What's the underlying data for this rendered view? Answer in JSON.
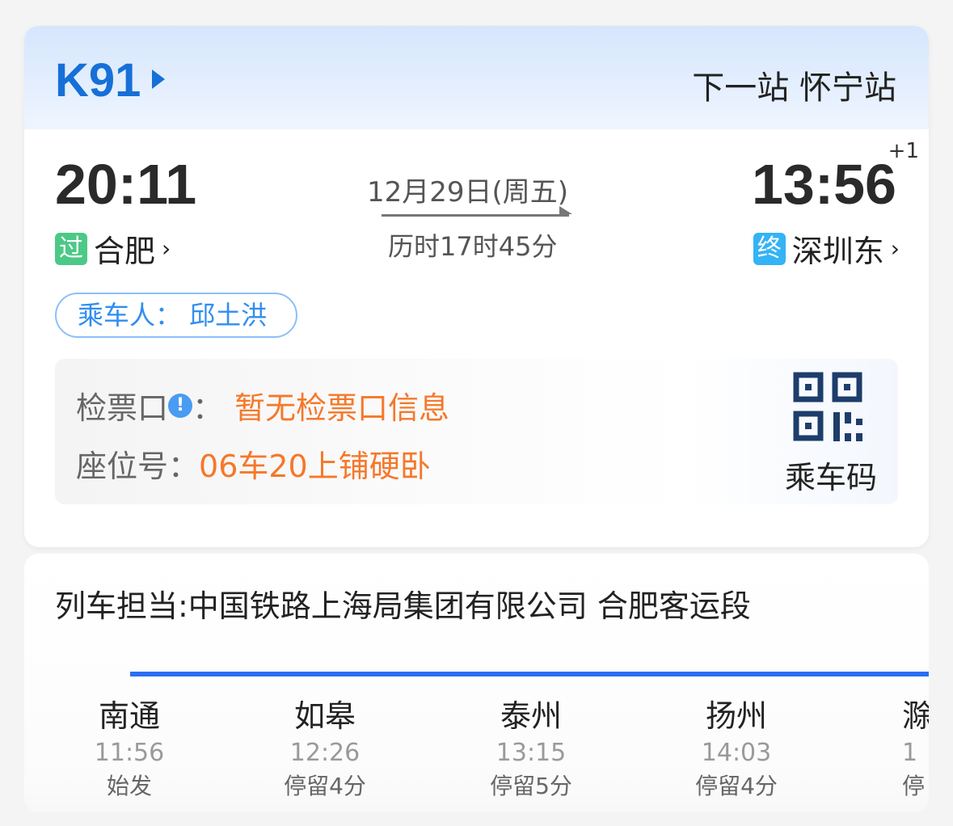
{
  "train": {
    "number": "K91",
    "next_station": "下一站 怀宁站"
  },
  "journey": {
    "depart_time": "20:11",
    "depart_tag": "过",
    "depart_station": "合肥",
    "arrive_time": "13:56",
    "day_offset": "+1",
    "arrive_tag": "终",
    "arrive_station": "深圳东",
    "date": "12月29日(周五)",
    "duration": "历时17时45分"
  },
  "passenger": "乘车人： 邱土洪",
  "ticket": {
    "gate_label": "检票口",
    "gate_sep": "：",
    "gate_value": "暂无检票口信息",
    "seat_label": "座位号：",
    "seat_value": "06车20上铺硬卧",
    "qr_label": "乘车码"
  },
  "crew": "列车担当:中国铁路上海局集团有限公司 合肥客运段",
  "stations": [
    {
      "name": "南通",
      "time": "11:56",
      "stop": "始发"
    },
    {
      "name": "如皋",
      "time": "12:26",
      "stop": "停留4分"
    },
    {
      "name": "泰州",
      "time": "13:15",
      "stop": "停留5分"
    },
    {
      "name": "扬州",
      "time": "14:03",
      "stop": "停留4分"
    },
    {
      "name": "滁",
      "time": "1",
      "stop": "停"
    }
  ],
  "colors": {
    "brand": "#1670d8",
    "accent": "#f5782a",
    "line": "#2a6ef5"
  }
}
